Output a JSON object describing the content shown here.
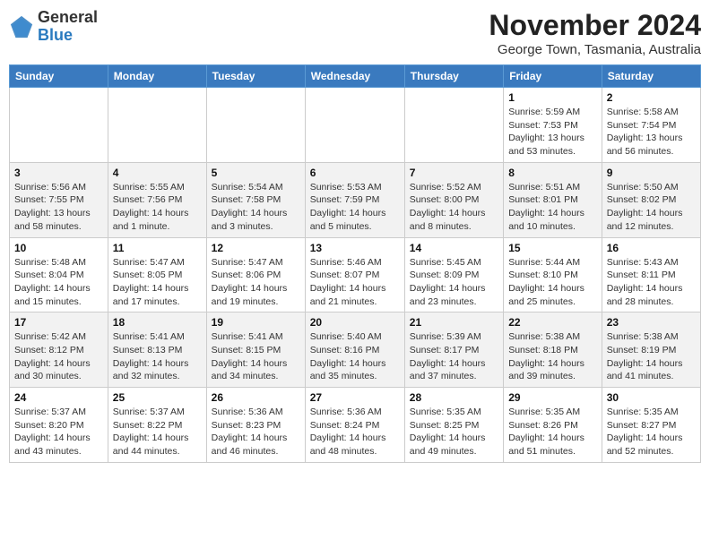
{
  "logo": {
    "general": "General",
    "blue": "Blue"
  },
  "header": {
    "month": "November 2024",
    "location": "George Town, Tasmania, Australia"
  },
  "weekdays": [
    "Sunday",
    "Monday",
    "Tuesday",
    "Wednesday",
    "Thursday",
    "Friday",
    "Saturday"
  ],
  "weeks": [
    [
      {
        "day": "",
        "info": ""
      },
      {
        "day": "",
        "info": ""
      },
      {
        "day": "",
        "info": ""
      },
      {
        "day": "",
        "info": ""
      },
      {
        "day": "",
        "info": ""
      },
      {
        "day": "1",
        "info": "Sunrise: 5:59 AM\nSunset: 7:53 PM\nDaylight: 13 hours and 53 minutes."
      },
      {
        "day": "2",
        "info": "Sunrise: 5:58 AM\nSunset: 7:54 PM\nDaylight: 13 hours and 56 minutes."
      }
    ],
    [
      {
        "day": "3",
        "info": "Sunrise: 5:56 AM\nSunset: 7:55 PM\nDaylight: 13 hours and 58 minutes."
      },
      {
        "day": "4",
        "info": "Sunrise: 5:55 AM\nSunset: 7:56 PM\nDaylight: 14 hours and 1 minute."
      },
      {
        "day": "5",
        "info": "Sunrise: 5:54 AM\nSunset: 7:58 PM\nDaylight: 14 hours and 3 minutes."
      },
      {
        "day": "6",
        "info": "Sunrise: 5:53 AM\nSunset: 7:59 PM\nDaylight: 14 hours and 5 minutes."
      },
      {
        "day": "7",
        "info": "Sunrise: 5:52 AM\nSunset: 8:00 PM\nDaylight: 14 hours and 8 minutes."
      },
      {
        "day": "8",
        "info": "Sunrise: 5:51 AM\nSunset: 8:01 PM\nDaylight: 14 hours and 10 minutes."
      },
      {
        "day": "9",
        "info": "Sunrise: 5:50 AM\nSunset: 8:02 PM\nDaylight: 14 hours and 12 minutes."
      }
    ],
    [
      {
        "day": "10",
        "info": "Sunrise: 5:48 AM\nSunset: 8:04 PM\nDaylight: 14 hours and 15 minutes."
      },
      {
        "day": "11",
        "info": "Sunrise: 5:47 AM\nSunset: 8:05 PM\nDaylight: 14 hours and 17 minutes."
      },
      {
        "day": "12",
        "info": "Sunrise: 5:47 AM\nSunset: 8:06 PM\nDaylight: 14 hours and 19 minutes."
      },
      {
        "day": "13",
        "info": "Sunrise: 5:46 AM\nSunset: 8:07 PM\nDaylight: 14 hours and 21 minutes."
      },
      {
        "day": "14",
        "info": "Sunrise: 5:45 AM\nSunset: 8:09 PM\nDaylight: 14 hours and 23 minutes."
      },
      {
        "day": "15",
        "info": "Sunrise: 5:44 AM\nSunset: 8:10 PM\nDaylight: 14 hours and 25 minutes."
      },
      {
        "day": "16",
        "info": "Sunrise: 5:43 AM\nSunset: 8:11 PM\nDaylight: 14 hours and 28 minutes."
      }
    ],
    [
      {
        "day": "17",
        "info": "Sunrise: 5:42 AM\nSunset: 8:12 PM\nDaylight: 14 hours and 30 minutes."
      },
      {
        "day": "18",
        "info": "Sunrise: 5:41 AM\nSunset: 8:13 PM\nDaylight: 14 hours and 32 minutes."
      },
      {
        "day": "19",
        "info": "Sunrise: 5:41 AM\nSunset: 8:15 PM\nDaylight: 14 hours and 34 minutes."
      },
      {
        "day": "20",
        "info": "Sunrise: 5:40 AM\nSunset: 8:16 PM\nDaylight: 14 hours and 35 minutes."
      },
      {
        "day": "21",
        "info": "Sunrise: 5:39 AM\nSunset: 8:17 PM\nDaylight: 14 hours and 37 minutes."
      },
      {
        "day": "22",
        "info": "Sunrise: 5:38 AM\nSunset: 8:18 PM\nDaylight: 14 hours and 39 minutes."
      },
      {
        "day": "23",
        "info": "Sunrise: 5:38 AM\nSunset: 8:19 PM\nDaylight: 14 hours and 41 minutes."
      }
    ],
    [
      {
        "day": "24",
        "info": "Sunrise: 5:37 AM\nSunset: 8:20 PM\nDaylight: 14 hours and 43 minutes."
      },
      {
        "day": "25",
        "info": "Sunrise: 5:37 AM\nSunset: 8:22 PM\nDaylight: 14 hours and 44 minutes."
      },
      {
        "day": "26",
        "info": "Sunrise: 5:36 AM\nSunset: 8:23 PM\nDaylight: 14 hours and 46 minutes."
      },
      {
        "day": "27",
        "info": "Sunrise: 5:36 AM\nSunset: 8:24 PM\nDaylight: 14 hours and 48 minutes."
      },
      {
        "day": "28",
        "info": "Sunrise: 5:35 AM\nSunset: 8:25 PM\nDaylight: 14 hours and 49 minutes."
      },
      {
        "day": "29",
        "info": "Sunrise: 5:35 AM\nSunset: 8:26 PM\nDaylight: 14 hours and 51 minutes."
      },
      {
        "day": "30",
        "info": "Sunrise: 5:35 AM\nSunset: 8:27 PM\nDaylight: 14 hours and 52 minutes."
      }
    ]
  ]
}
